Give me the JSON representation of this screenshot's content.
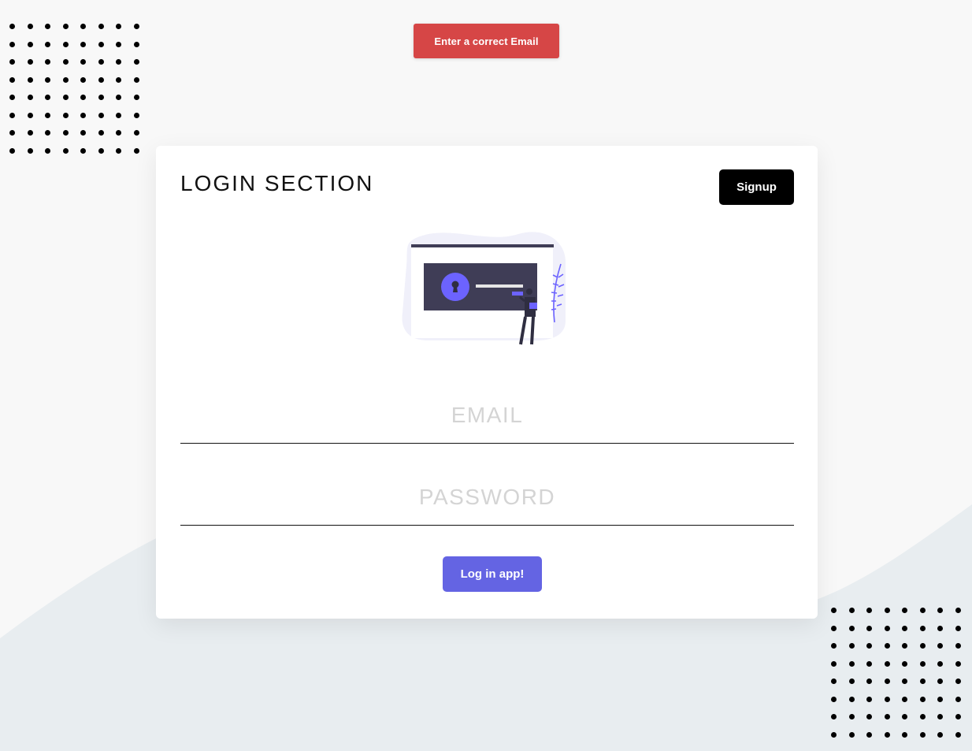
{
  "toast": {
    "message": "Enter a correct Email",
    "color": "#d64646"
  },
  "card": {
    "title": "LOGIN SECTION",
    "signup_label": "Signup",
    "email_placeholder": "EMAIL",
    "password_placeholder": "PASSWORD",
    "login_label": "Log in app!"
  },
  "colors": {
    "accent": "#6464e3",
    "background": "#f8f8f8",
    "wave": "#e8edf0"
  },
  "illustration": {
    "icon": "login-lock-illustration"
  }
}
